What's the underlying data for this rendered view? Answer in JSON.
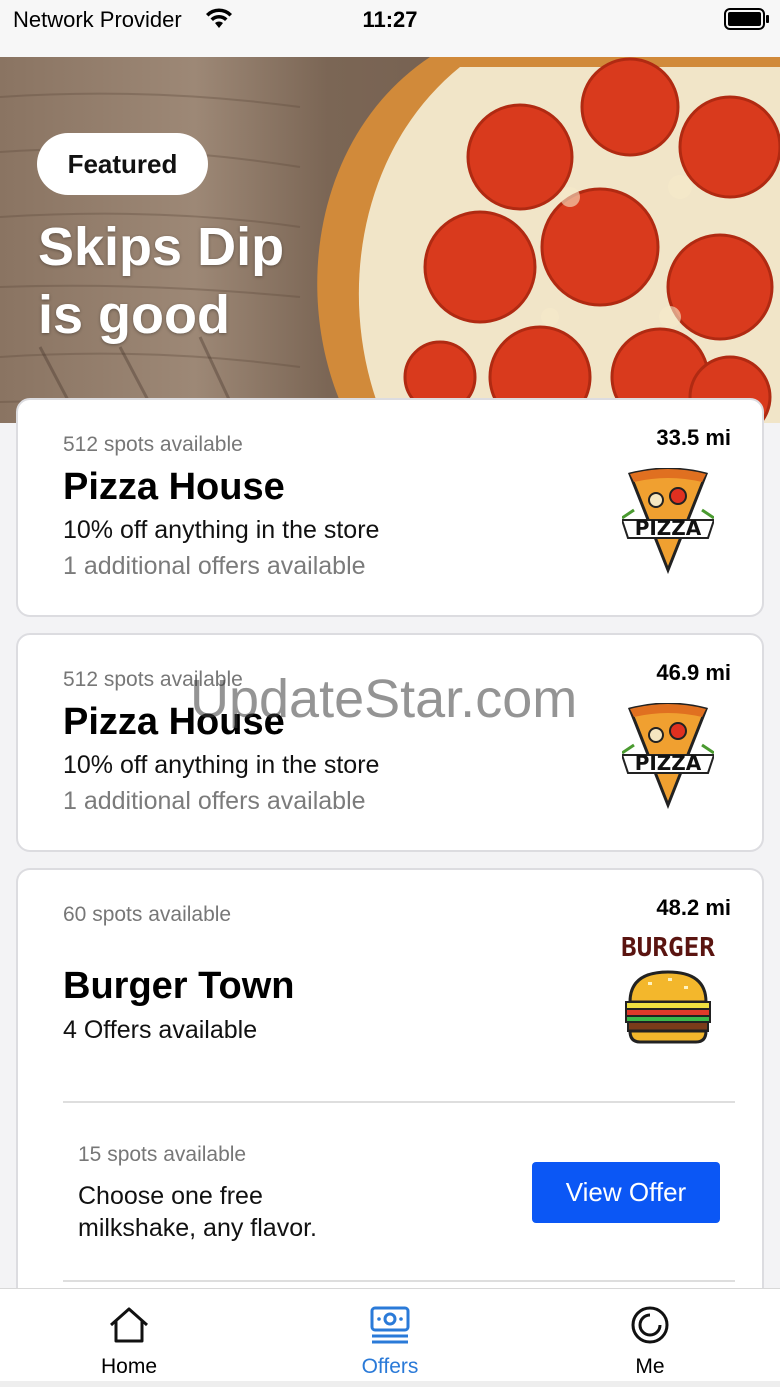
{
  "status_bar": {
    "carrier": "Network Provider",
    "time": "11:27"
  },
  "hero": {
    "badge": "Featured",
    "title_line1": "Skips Dip",
    "title_line2": "is good"
  },
  "listings": [
    {
      "spots": "512 spots available",
      "distance": "33.5 mi",
      "name": "Pizza House",
      "offer": "10% off anything in the store",
      "extra": "1 additional offers available",
      "logo_text": "PIZZA"
    },
    {
      "spots": "512 spots available",
      "distance": "46.9 mi",
      "name": "Pizza House",
      "offer": "10% off anything in the store",
      "extra": "1 additional offers available",
      "logo_text": "PIZZA"
    },
    {
      "spots": "60 spots available",
      "distance": "48.2 mi",
      "name": "Burger Town",
      "offer": "4 Offers available",
      "logo_text": "BURGER",
      "sub_offer": {
        "spots": "15 spots available",
        "description": "Choose one free milkshake, any flavor.",
        "button_label": "View Offer"
      }
    }
  ],
  "watermark": "UpdateStar.com",
  "tabs": [
    {
      "label": "Home",
      "icon": "home-icon"
    },
    {
      "label": "Offers",
      "icon": "offers-icon",
      "active": true
    },
    {
      "label": "Me",
      "icon": "profile-icon"
    }
  ],
  "colors": {
    "accent": "#0b57f5",
    "active_tab": "#2a7ad8"
  }
}
